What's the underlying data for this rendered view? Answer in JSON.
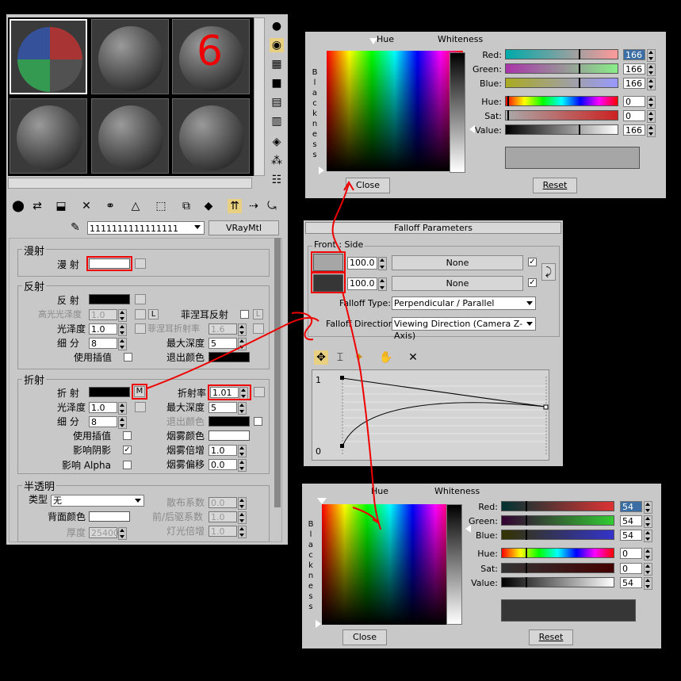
{
  "mat_editor": {
    "material_name": "1111111111111111",
    "material_type": "VRayMtl",
    "sample_label": "6",
    "diffuse": {
      "group": "漫射",
      "diffuse_label": "漫 射"
    },
    "reflect": {
      "group": "反射",
      "reflect_label": "反 射",
      "hilight_gloss": "高光光泽度",
      "hilight_val": "1.0",
      "l_btn": "L",
      "fresnel": "菲涅耳反射",
      "fresnel_l": "L",
      "gloss": "光泽度",
      "gloss_val": "1.0",
      "fresnel_ior": "菲涅耳折射率",
      "fresnel_ior_val": "1.6",
      "subdivs": "细 分",
      "subdivs_val": "8",
      "max_depth": "最大深度",
      "max_depth_val": "5",
      "use_interp": "使用插值",
      "exit_color": "退出颜色"
    },
    "refract": {
      "group": "折射",
      "refract_label": "折 射",
      "m_btn": "M",
      "ior": "折射率",
      "ior_val": "1.01",
      "gloss": "光泽度",
      "gloss_val": "1.0",
      "max_depth": "最大深度",
      "max_depth_val": "5",
      "subdivs": "细 分",
      "subdivs_val": "8",
      "exit_color": "退出颜色",
      "use_interp": "使用插值",
      "fog_color": "烟雾颜色",
      "affect_shadows": "影响阴影",
      "fog_mult": "烟雾倍增",
      "fog_mult_val": "1.0",
      "affect_alpha": "影响 Alpha",
      "fog_bias": "烟雾偏移",
      "fog_bias_val": "0.0"
    },
    "translucency": {
      "group": "半透明",
      "type": "类型",
      "type_val": "无",
      "scatter": "散布系数",
      "scatter_val": "0.0",
      "back_color": "背面颜色",
      "fwd_bck": "前/后驱系数",
      "fwd_bck_val": "1.0",
      "thickness": "厚度",
      "thickness_val": "25400.",
      "light_mult": "灯光倍增",
      "light_mult_val": "1.0"
    }
  },
  "falloff": {
    "title": "Falloff Parameters",
    "front_side": "Front : Side",
    "val1": "100.0",
    "val2": "100.0",
    "none1": "None",
    "none2": "None",
    "type_label": "Falloff Type:",
    "type_val": "Perpendicular / Parallel",
    "dir_label": "Falloff Direction:",
    "dir_val": "Viewing Direction (Camera Z-Axis)",
    "curve_top": "1",
    "curve_bottom": "0"
  },
  "picker_top": {
    "hue": "Hue",
    "whiteness": "Whiteness",
    "blackness": "Blackness",
    "red": "Red:",
    "green": "Green:",
    "blue": "Blue:",
    "hue2": "Hue:",
    "sat": "Sat:",
    "value": "Value:",
    "red_val": "166",
    "green_val": "166",
    "blue_val": "166",
    "hue_val": "0",
    "sat_val": "0",
    "value_val": "166",
    "close": "Close",
    "reset": "Reset",
    "swatch": "#a6a6a6"
  },
  "picker_bottom": {
    "hue": "Hue",
    "whiteness": "Whiteness",
    "blackness": "Blackness",
    "red": "Red:",
    "green": "Green:",
    "blue": "Blue:",
    "hue2": "Hue:",
    "sat": "Sat:",
    "value": "Value:",
    "red_val": "54",
    "green_val": "54",
    "blue_val": "54",
    "hue_val": "0",
    "sat_val": "0",
    "value_val": "54",
    "close": "Close",
    "reset": "Reset",
    "swatch": "#363636"
  }
}
